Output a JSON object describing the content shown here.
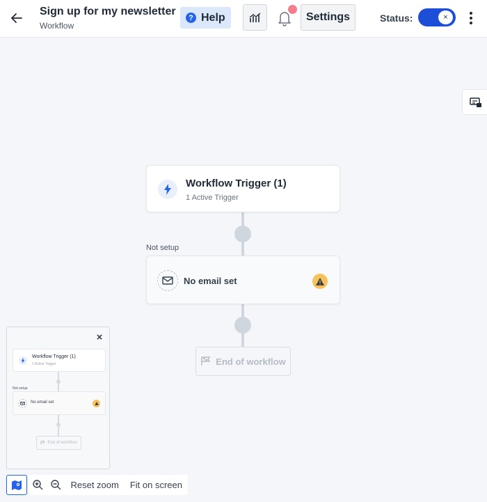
{
  "header": {
    "title": "Sign up for my newsletter",
    "subtitle": "Workflow",
    "help_label": "Help",
    "settings_label": "Settings",
    "status_label": "Status:",
    "status_toggle_mark": "×"
  },
  "canvas": {
    "trigger": {
      "title": "Workflow Trigger (1)",
      "subtitle": "1 Active Trigger"
    },
    "step_status": "Not setup",
    "email_step": {
      "label": "No email set"
    },
    "end_label": "End of workflow"
  },
  "minimap": {
    "close_label": "×",
    "trigger_title": "Workflow Trigger (1)",
    "trigger_sub": "1 Active Trigger",
    "step_status": "Not setup",
    "email_label": "No email set",
    "end_label": "End of workflow"
  },
  "toolbar": {
    "reset_zoom": "Reset zoom",
    "fit_on_screen": "Fit on screen"
  },
  "colors": {
    "accent": "#2563eb",
    "toggle_on": "#1d4ed8",
    "warning": "#f6c25c",
    "notification_dot": "#f47f8c"
  }
}
